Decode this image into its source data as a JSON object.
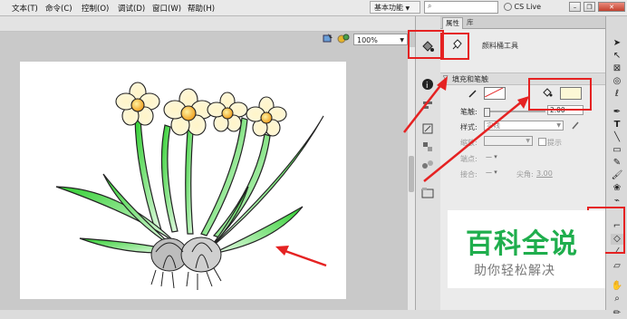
{
  "menu": {
    "items": [
      "文本(T)",
      "命令(C)",
      "控制(O)",
      "调试(D)",
      "窗口(W)",
      "帮助(H)"
    ]
  },
  "workspace": {
    "label": "基本功能"
  },
  "search": {
    "placeholder": ""
  },
  "cslive": {
    "label": "CS Live"
  },
  "stage": {
    "zoom": "100%"
  },
  "panel": {
    "tab_properties": "属性",
    "tab_library": "库",
    "tool_name": "颜料桶工具",
    "section_title": "填充和笔触",
    "stroke_width_label": "笔触:",
    "stroke_width_value": "2.00",
    "style_label": "样式:",
    "style_value": "实线",
    "scale_label": "缩放:",
    "hint_label": "提示",
    "cap_label": "端点:",
    "join_label": "接合:",
    "miter_label": "尖角:",
    "miter_value": "3.00"
  },
  "colors": {
    "fill_swatch": "#fcf8d6",
    "stroke_swatch": "#ffffff",
    "highlight": "#e52222",
    "watermark_green": "#1fae4d"
  },
  "watermark": {
    "title": "百科全说",
    "subtitle": "助你轻松解决"
  }
}
